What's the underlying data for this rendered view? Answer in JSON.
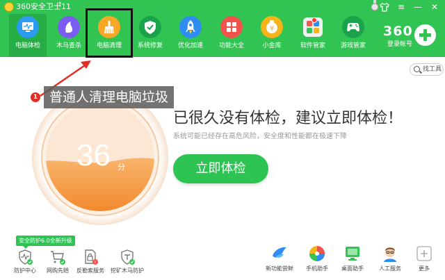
{
  "app": {
    "title": "360安全卫士11",
    "upgrade_icon": "up-arrow-icon"
  },
  "window": {
    "controls": [
      "shirt-icon",
      "menu-icon",
      "minimize-icon",
      "close-icon"
    ]
  },
  "nav": {
    "items": [
      {
        "label": "电脑体检",
        "icon": "monitor-icon",
        "color": "#2b9cf0",
        "active": true
      },
      {
        "label": "木马查杀",
        "icon": "horse-icon",
        "color": "#7b5cf0"
      },
      {
        "label": "电脑清理",
        "icon": "broom-icon",
        "color": "#f7a827"
      },
      {
        "label": "系统修复",
        "icon": "shield-icon",
        "color": "#1aa34a"
      },
      {
        "label": "优化加速",
        "icon": "rocket-icon",
        "color": "#2f8cf0"
      },
      {
        "label": "功能大全",
        "icon": "grid-icon",
        "color": "#f0534c"
      },
      {
        "label": "小金库",
        "icon": "coin-icon",
        "color": "#f7b31a"
      },
      {
        "label": "软件管家",
        "icon": "apps-icon",
        "color": "#f0f0f0"
      },
      {
        "label": "游戏管家",
        "icon": "gamepad-icon",
        "color": "#1aa34a"
      }
    ],
    "brand": "360",
    "login_label": "登录帐号"
  },
  "tools": {
    "label": "找工具"
  },
  "annotation": {
    "number": "1",
    "text": "普通人清理电脑垃圾"
  },
  "score": {
    "value": "36",
    "unit": "分",
    "fill_level": 0.45
  },
  "main": {
    "headline": "已很久没有体检，建议立即体检！",
    "subline": "系统可能已经存在高危风险，安全度和性能都在极速下降",
    "check_button": "立即体检"
  },
  "bottom": {
    "upgrade_tag": "安全防护6.0全新升级",
    "left_items": [
      {
        "label": "防护中心",
        "icon": "pulse-shield-icon"
      },
      {
        "label": "网购先赔",
        "icon": "cart-icon"
      },
      {
        "label": "反勒索服务",
        "icon": "lock-file-icon"
      },
      {
        "label": "挖矿木马防护",
        "icon": "miner-shield-icon"
      }
    ],
    "right_items": [
      {
        "label": "新功能尝鲜",
        "icon": "bird-icon"
      },
      {
        "label": "手机助手",
        "icon": "pinwheel-icon"
      },
      {
        "label": "桌面助手",
        "icon": "desktop-icon"
      },
      {
        "label": "人工服务",
        "icon": "agent-icon"
      },
      {
        "label": "更多",
        "icon": "plus-box-icon"
      }
    ]
  }
}
